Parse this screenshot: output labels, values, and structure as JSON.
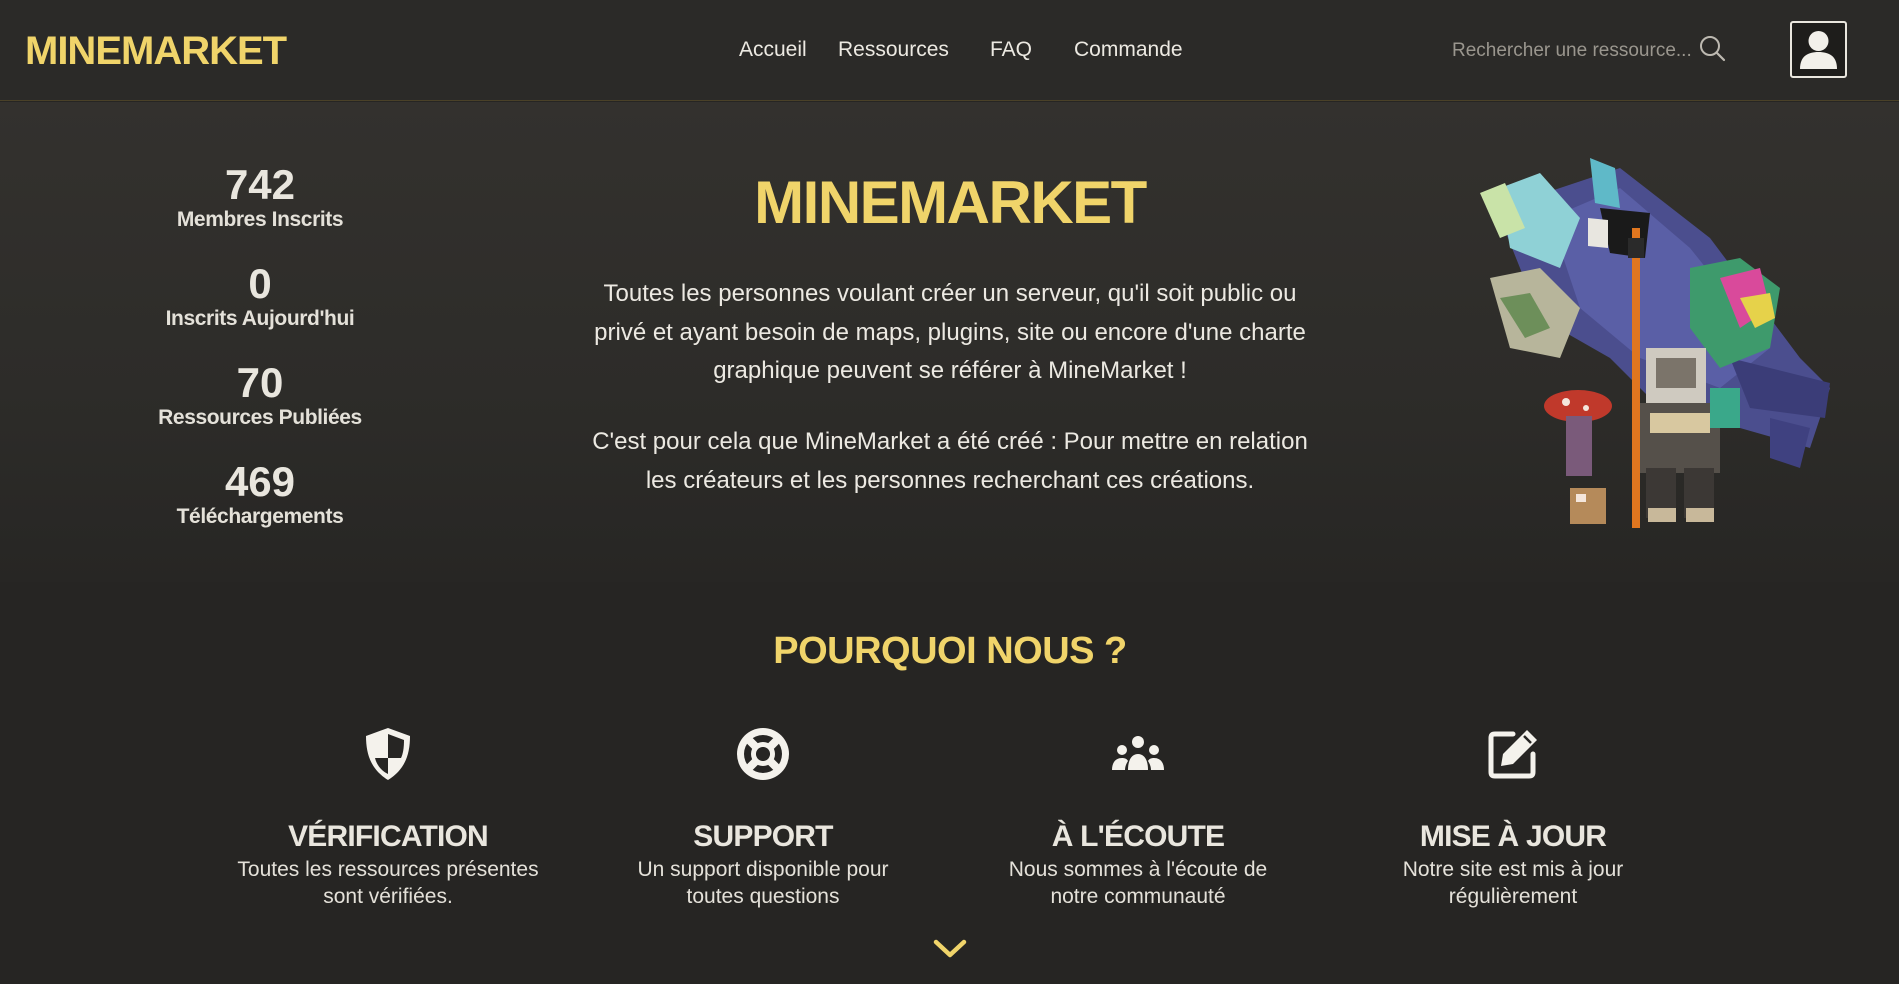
{
  "brand": {
    "name": "MINEMARKET",
    "accent_color": "#f0d46a"
  },
  "nav": {
    "links": [
      {
        "label": "Accueil"
      },
      {
        "label": "Ressources"
      },
      {
        "label": "FAQ"
      },
      {
        "label": "Commande"
      }
    ],
    "search": {
      "placeholder": "Rechercher une ressource...",
      "icon": "search-icon"
    },
    "account": {
      "icon": "user-icon"
    }
  },
  "stats": [
    {
      "value": "742",
      "label": "Membres Inscrits"
    },
    {
      "value": "0",
      "label": "Inscrits Aujourd'hui"
    },
    {
      "value": "70",
      "label": "Ressources Publiées"
    },
    {
      "value": "469",
      "label": "Téléchargements"
    }
  ],
  "hero": {
    "title": "MINEMARKET",
    "paragraph1_lines": [
      "Toutes les personnes voulant créer un serveur, qu'il soit public ou",
      "privé et ayant besoin de maps, plugins, site ou encore d'une charte",
      "graphique peuvent se référer à MineMarket !"
    ],
    "paragraph2_lines": [
      "C'est pour cela que MineMarket a été créé : Pour mettre en relation",
      "les créateurs et les personnes recherchant ces créations."
    ]
  },
  "why": {
    "title": "POURQUOI NOUS ?",
    "features": [
      {
        "icon": "shield-icon",
        "title": "VÉRIFICATION",
        "desc_lines": [
          "Toutes les ressources présentes",
          "sont vérifiées."
        ]
      },
      {
        "icon": "lifebuoy-icon",
        "title": "SUPPORT",
        "desc_lines": [
          "Un support disponible pour",
          "toutes questions"
        ]
      },
      {
        "icon": "community-icon",
        "title": "À L'ÉCOUTE",
        "desc_lines": [
          "Nous sommes à l'écoute de",
          "notre communauté"
        ]
      },
      {
        "icon": "edit-icon",
        "title": "MISE À JOUR",
        "desc_lines": [
          "Notre site est mis à jour",
          "régulièrement"
        ]
      }
    ]
  },
  "scroll": {
    "icon": "chevron-down-icon"
  }
}
